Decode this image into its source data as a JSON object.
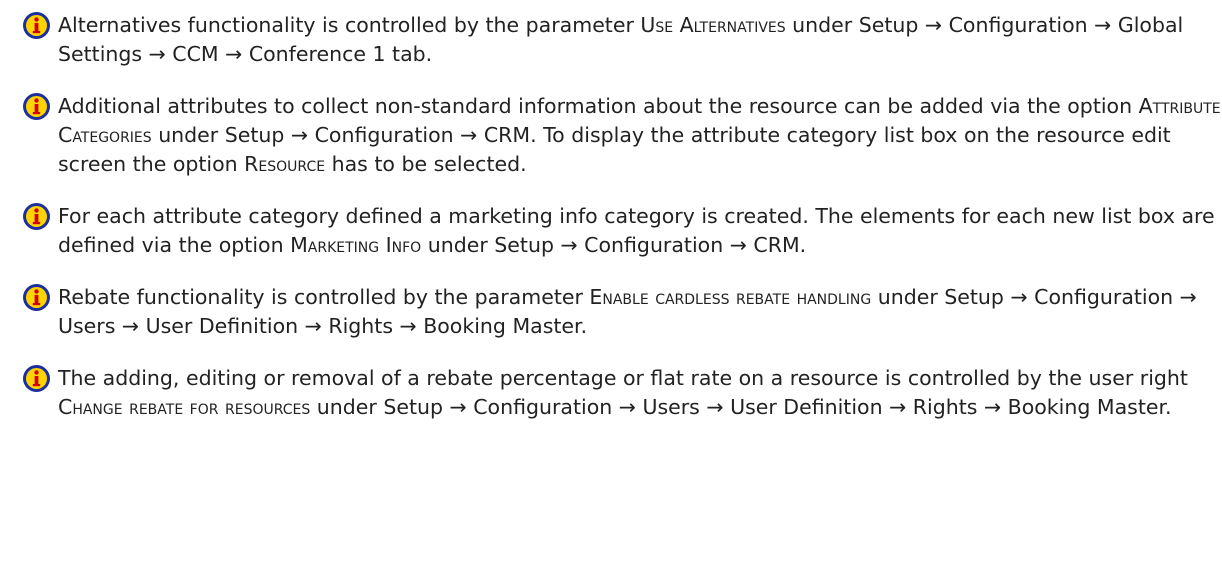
{
  "colors": {
    "icon_ring": "#1d2f9e",
    "icon_fill": "#ffd400",
    "icon_glyph": "#d40000",
    "text": "#222222"
  },
  "icon_name": "info-icon",
  "notes": [
    {
      "text_1": "Alternatives functionality is controlled by the parameter ",
      "option": "Use Alternatives",
      "text_2": " under Setup → Configuration → Global Settings → CCM → Conference 1 tab."
    },
    {
      "text_1": "Additional attributes to collect non-standard information about the resource can be added via the option ",
      "option": "Attribute Categories",
      "text_2": " under Setup → Configuration → CRM. To display the attribute category list box on the resource edit screen the option ",
      "option_2": "Resource",
      "text_3": " has to be selected."
    },
    {
      "text_1": "For each attribute category defined a marketing info category is created. The elements for each new list box are defined via the option ",
      "option": "Marketing Info",
      "text_2": " under Setup → Configuration → CRM."
    },
    {
      "text_1": "Rebate functionality is controlled by the parameter ",
      "option": "Enable cardless rebate handling",
      "text_2": " under Setup → Configuration → Users → User Definition → Rights → Booking Master."
    },
    {
      "text_1": "The adding, editing or removal of a rebate percentage or flat rate on a resource is controlled by the user right ",
      "option": "Change rebate for resources",
      "text_2": " under Setup → Configuration → Users → User Definition → Rights → Booking Master."
    }
  ]
}
